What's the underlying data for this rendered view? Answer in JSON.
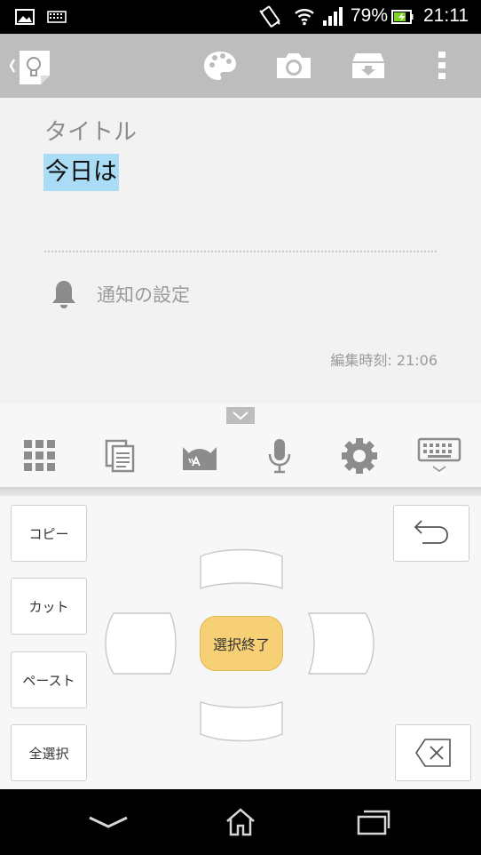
{
  "status_bar": {
    "battery": "79%",
    "time": "21:11",
    "icons": [
      "image-notification-icon",
      "keyboard-notification-icon",
      "vibrate-icon",
      "wifi-icon",
      "signal-icon",
      "battery-charging-icon"
    ],
    "battery_color": "#7ed321"
  },
  "action_bar": {
    "icons": [
      "back-chevron-icon",
      "app-logo-icon",
      "palette-icon",
      "camera-icon",
      "archive-icon",
      "overflow-menu-icon"
    ]
  },
  "note": {
    "title_placeholder": "タイトル",
    "body_text": "今日は",
    "selection_color": "#aadcf5",
    "reminder_label": "通知の設定",
    "edited_time": "編集時刻: 21:06"
  },
  "keyboard": {
    "toolbar_icons": [
      "grid-icon",
      "clipboard-icon",
      "cat-emoji-icon",
      "microphone-icon",
      "settings-gear-icon",
      "keyboard-hide-icon"
    ],
    "keys": {
      "copy": "コピー",
      "cut": "カット",
      "paste": "ペースト",
      "select_all": "全選択",
      "end_selection": "選択終了"
    },
    "accent_color": "#f7cf74"
  },
  "nav_bar": {
    "icons": [
      "back-icon",
      "home-icon",
      "recent-apps-icon"
    ]
  }
}
